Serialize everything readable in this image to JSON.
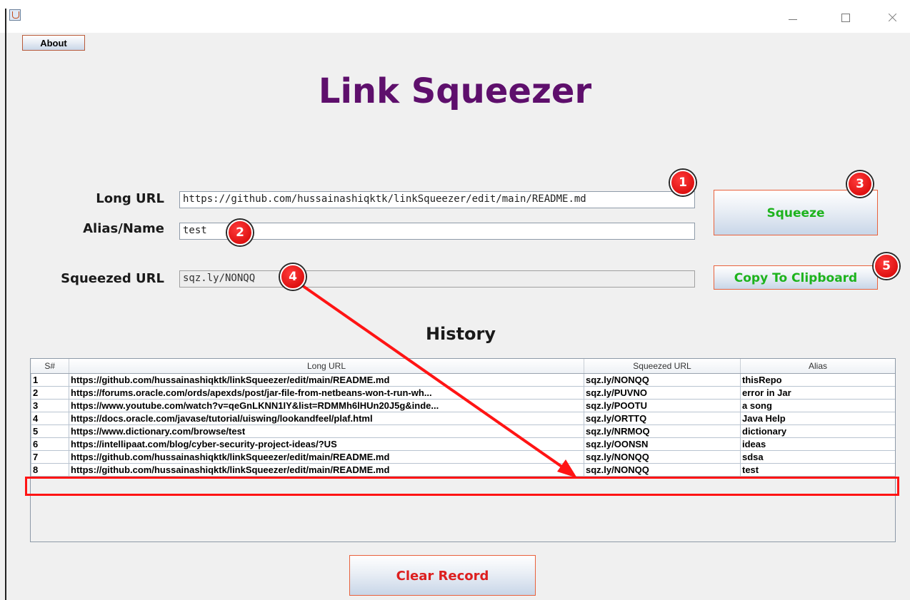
{
  "window": {
    "icon": "java-icon",
    "controls": [
      "minimize-icon",
      "maximize-icon",
      "close-icon"
    ]
  },
  "menu": {
    "about_label": "About"
  },
  "app_title": "Link Squeezer",
  "form": {
    "long_url_label": "Long URL",
    "long_url_value": "https://github.com/hussainashiqktk/linkSqueezer/edit/main/README.md",
    "alias_label": "Alias/Name",
    "alias_value": "test",
    "squeezed_label": "Squeezed URL",
    "squeezed_value": "sqz.ly/NONQQ",
    "squeeze_button": "Squeeze",
    "copy_button": "Copy To Clipboard"
  },
  "history": {
    "title": "History",
    "columns": [
      "S#",
      "Long URL",
      "Squeezed URL",
      "Alias"
    ],
    "rows": [
      [
        "1",
        "https://github.com/hussainashiqktk/linkSqueezer/edit/main/README.md",
        "sqz.ly/NONQQ",
        "thisRepo"
      ],
      [
        "2",
        "https://forums.oracle.com/ords/apexds/post/jar-file-from-netbeans-won-t-run-wh...",
        "sqz.ly/PUVNO",
        "error in Jar"
      ],
      [
        "3",
        "https://www.youtube.com/watch?v=qeGnLKNN1IY&list=RDMMh6lHUn20J5g&inde...",
        "sqz.ly/POOTU",
        "a song"
      ],
      [
        "4",
        "https://docs.oracle.com/javase/tutorial/uiswing/lookandfeel/plaf.html",
        "sqz.ly/ORTTQ",
        "Java Help"
      ],
      [
        "5",
        "https://www.dictionary.com/browse/test",
        "sqz.ly/NRMOQ",
        "dictionary"
      ],
      [
        "6",
        "https://intellipaat.com/blog/cyber-security-project-ideas/?US",
        "sqz.ly/OONSN",
        "ideas"
      ],
      [
        "7",
        "https://github.com/hussainashiqktk/linkSqueezer/edit/main/README.md",
        "sqz.ly/NONQQ",
        "sdsa"
      ],
      [
        "8",
        "https://github.com/hussainashiqktk/linkSqueezer/edit/main/README.md",
        "sqz.ly/NONQQ",
        "test"
      ]
    ]
  },
  "clear_button": "Clear Record",
  "annotations": {
    "badges": [
      "1",
      "2",
      "3",
      "4",
      "5"
    ],
    "color": "#ff0000"
  }
}
